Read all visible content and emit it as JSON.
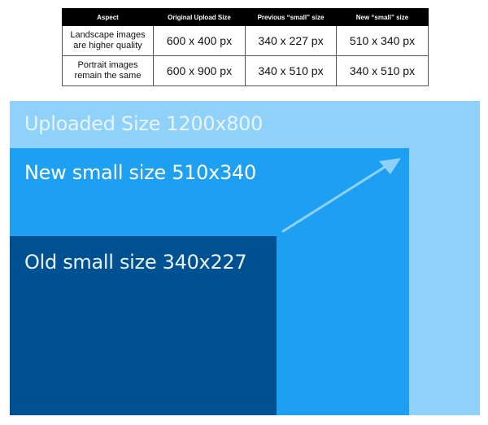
{
  "table": {
    "headers": [
      "Aspect",
      "Original Upload Size",
      "Previous “small” size",
      "New “small” size"
    ],
    "rows": [
      {
        "aspect_line1": "Landscape images",
        "aspect_line2": "are higher quality",
        "original": "600 x 400 px",
        "previous_small": "340 x 227 px",
        "new_small": "510 x 340 px"
      },
      {
        "aspect_line1": "Portrait images",
        "aspect_line2": "remain the same",
        "original": "600 x 900 px",
        "previous_small": "340 x 510 px",
        "new_small": "340 x 510 px"
      }
    ]
  },
  "diagram": {
    "boxes": [
      {
        "label": "Uploaded Size 1200x800",
        "color": "#90D1FA",
        "text_color": "#E6F4FE"
      },
      {
        "label": "New small size 510x340",
        "color": "#1EA0F2",
        "text_color": "#FFFFFF"
      },
      {
        "label": "Old small size 340x227",
        "color": "#005191",
        "text_color": "#EAF2F8"
      }
    ],
    "arrow": {
      "icon": "arrow-up-right-icon",
      "color": "#90D1FA",
      "meaning": "growth from old small size to new small size"
    }
  }
}
